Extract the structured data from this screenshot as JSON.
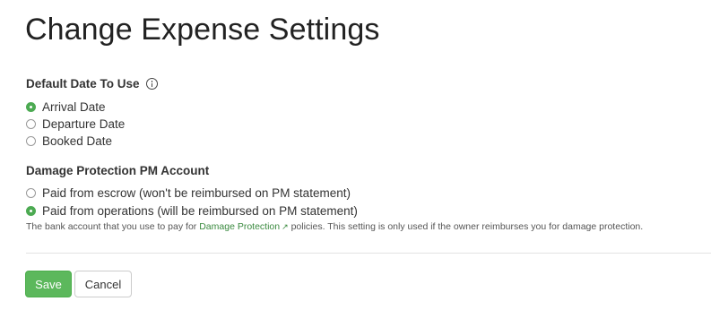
{
  "page": {
    "title": "Change Expense Settings"
  },
  "default_date": {
    "label": "Default Date To Use",
    "options": [
      {
        "label": "Arrival Date",
        "checked": true
      },
      {
        "label": "Departure Date",
        "checked": false
      },
      {
        "label": "Booked Date",
        "checked": false
      }
    ]
  },
  "damage_protection": {
    "label": "Damage Protection PM Account",
    "options": [
      {
        "label": "Paid from escrow (won't be reimbursed on PM statement)",
        "checked": false
      },
      {
        "label": "Paid from operations (will be reimbursed on PM statement)",
        "checked": true
      }
    ],
    "help_prefix": "The bank account that you use to pay for ",
    "help_link": "Damage Protection",
    "help_link_icon": "external-link-icon",
    "help_suffix": " policies. This setting is only used if the owner reimburses you for damage protection."
  },
  "buttons": {
    "save": "Save",
    "cancel": "Cancel"
  },
  "colors": {
    "accent": "#5cb85c",
    "link": "#3a8a3f",
    "radio_checked": "#4caa52"
  },
  "icons": {
    "info": "info-icon"
  }
}
